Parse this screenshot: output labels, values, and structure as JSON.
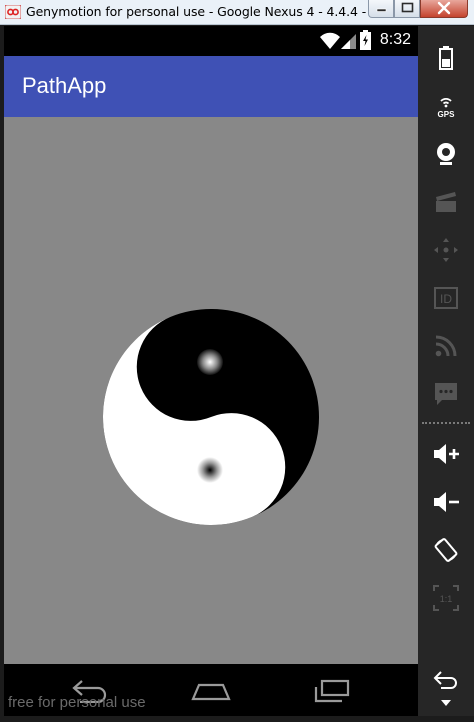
{
  "window": {
    "title": "Genymotion for personal use - Google Nexus 4 - 4.4.4 - ..."
  },
  "device": {
    "status_bar": {
      "time": "8:32"
    },
    "app_bar": {
      "title": "PathApp"
    },
    "content": {
      "background_color": "#888888",
      "drawing": "yin-yang-icon"
    },
    "nav_bar": {
      "buttons": [
        "back-icon",
        "home-icon",
        "recent-apps-icon"
      ]
    },
    "watermark": "free for personal use"
  },
  "toolbar": {
    "items": [
      "battery-icon",
      "gps-icon",
      "webcam-icon",
      "capture-icon",
      "remote-control-icon",
      "id-icon",
      "rss-icon",
      "sms-icon",
      "volume-up-icon",
      "volume-down-icon",
      "rotate-icon",
      "pixel-perfect-icon",
      "back-icon",
      "menu-icon"
    ],
    "gps_label": "GPS",
    "id_label": "ID",
    "pixel_label": "1:1"
  },
  "colors": {
    "app_bar": "#3f51b5",
    "toolbar_bg": "#262626",
    "title_bar": "#eaf1f8"
  }
}
